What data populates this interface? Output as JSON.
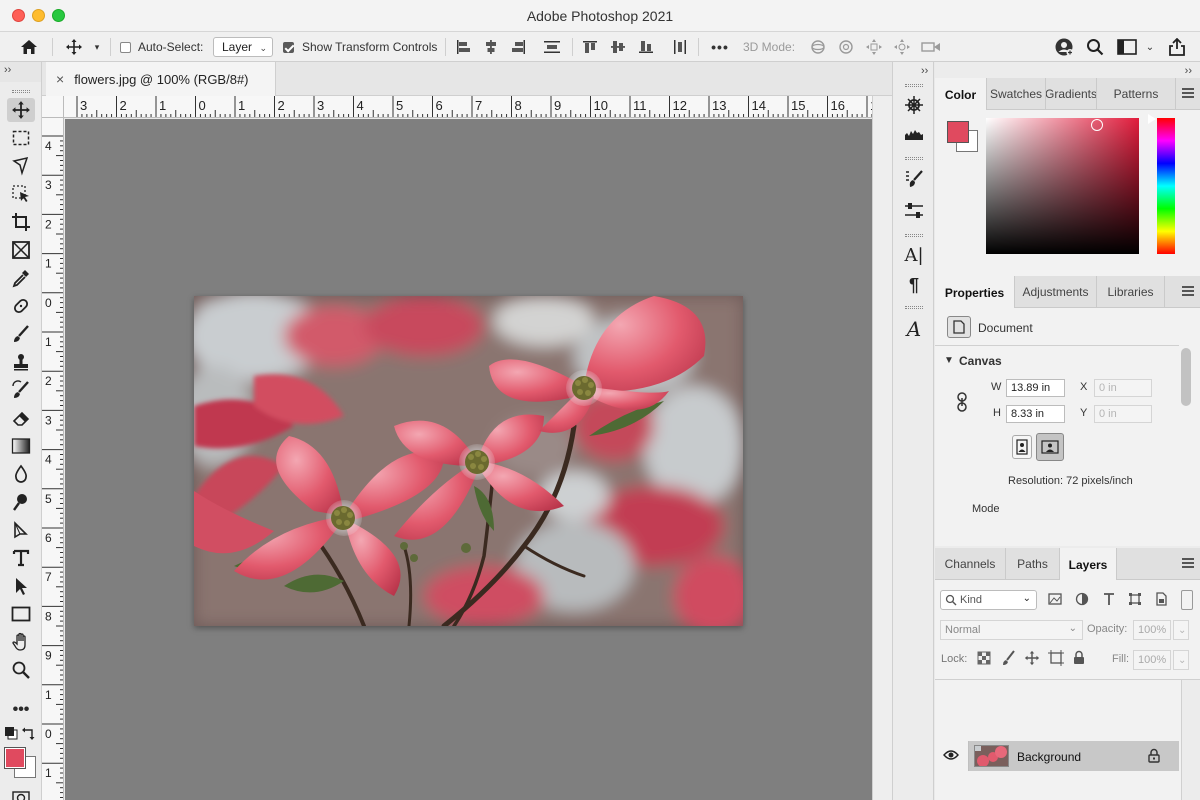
{
  "app": {
    "title": "Adobe Photoshop 2021"
  },
  "options_bar": {
    "auto_select_label": "Auto-Select:",
    "auto_select_checked": false,
    "auto_select_target": "Layer",
    "show_transform_label": "Show Transform Controls",
    "show_transform_checked": true,
    "mode_3d_label": "3D Mode:",
    "more_label": "•••"
  },
  "document": {
    "tab_title": "flowers.jpg @ 100% (RGB/8#)",
    "close_glyph": "×",
    "ruler_h_labels": [
      "3",
      "2",
      "1",
      "0",
      "1",
      "2",
      "3",
      "4",
      "5",
      "6",
      "7",
      "8",
      "9",
      "10",
      "11",
      "12",
      "13",
      "14",
      "15",
      "16",
      "1"
    ],
    "ruler_v_labels": [
      "4",
      "3",
      "2",
      "1",
      "0",
      "1",
      "2",
      "3",
      "4",
      "5",
      "6",
      "7",
      "8",
      "9",
      "1",
      "0",
      "1",
      "1",
      "1",
      "2"
    ]
  },
  "colors": {
    "foreground": "#e04a5f",
    "background": "#ffffff",
    "picker_hue": "#e11c3c",
    "canvas_bg": "#7f7f7f"
  },
  "color_panel": {
    "tabs": [
      "Color",
      "Swatches",
      "Gradients",
      "Patterns"
    ],
    "active": "Color"
  },
  "properties_panel": {
    "tabs": [
      "Properties",
      "Adjustments",
      "Libraries"
    ],
    "active": "Properties",
    "doc_label": "Document",
    "section": "Canvas",
    "w_label": "W",
    "w_value": "13.89 in",
    "h_label": "H",
    "h_value": "8.33 in",
    "x_label": "X",
    "x_value": "0 in",
    "y_label": "Y",
    "y_value": "0 in",
    "resolution": "Resolution: 72 pixels/inch",
    "mode_label": "Mode"
  },
  "layers_panel": {
    "tabs": [
      "Channels",
      "Paths",
      "Layers"
    ],
    "active": "Layers",
    "filter_label": "Kind",
    "blend_mode": "Normal",
    "opacity_label": "Opacity:",
    "opacity_value": "100%",
    "lock_label": "Lock:",
    "fill_label": "Fill:",
    "fill_value": "100%",
    "layers": [
      {
        "name": "Background",
        "visible": true,
        "locked": true
      }
    ]
  },
  "collapse_glyph": "››"
}
